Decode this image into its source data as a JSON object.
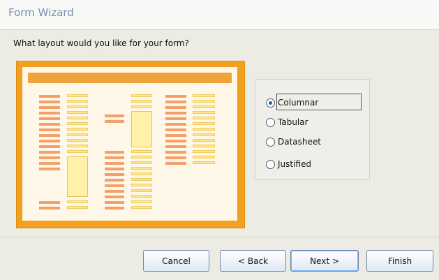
{
  "window": {
    "title": "Form Wizard"
  },
  "prompt": "What layout would you like for your form?",
  "layout_options": [
    {
      "label": "Columnar",
      "selected": true
    },
    {
      "label": "Tabular",
      "selected": false
    },
    {
      "label": "Datasheet",
      "selected": false
    },
    {
      "label": "Justified",
      "selected": false
    }
  ],
  "buttons": {
    "cancel": "Cancel",
    "back": "< Back",
    "next": "Next >",
    "finish": "Finish"
  },
  "colors": {
    "accent": "#f2a020",
    "dialog_bg": "#ecebe4"
  }
}
